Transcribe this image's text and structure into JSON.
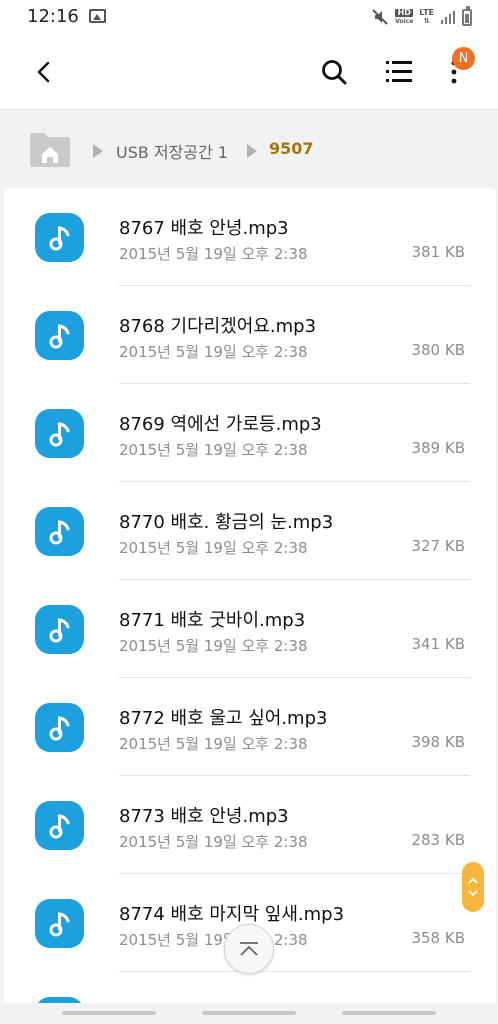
{
  "status_bar": {
    "time": "12:16",
    "hd_top": "HD",
    "hd_bottom": "Voice",
    "lte": "LTE"
  },
  "app_bar": {
    "back_icon": "back-arrow-icon",
    "search_icon": "search-icon",
    "list_icon": "list-view-icon",
    "more_icon": "more-vert-icon",
    "badge": "N"
  },
  "breadcrumb": {
    "home_icon": "home-folder-icon",
    "items": [
      "USB 저장공간 1",
      "9507"
    ]
  },
  "files": [
    {
      "name": "8767 배호  안녕.mp3",
      "date": "2015년 5월 19일 오후 2:38",
      "size": "381 KB"
    },
    {
      "name": "8768 기다리겠어요.mp3",
      "date": "2015년 5월 19일 오후 2:38",
      "size": "380 KB"
    },
    {
      "name": "8769 역에선 가로등.mp3",
      "date": "2015년 5월 19일 오후 2:38",
      "size": "389 KB"
    },
    {
      "name": "8770 배호. 황금의 눈.mp3",
      "date": "2015년 5월 19일 오후 2:38",
      "size": "327 KB"
    },
    {
      "name": "8771 배호  굿바이.mp3",
      "date": "2015년 5월 19일 오후 2:38",
      "size": "341 KB"
    },
    {
      "name": "8772 배호  울고 싶어.mp3",
      "date": "2015년 5월 19일 오후 2:38",
      "size": "398 KB"
    },
    {
      "name": "8773 배호  안녕.mp3",
      "date": "2015년 5월 19일 오후 2:38",
      "size": "283 KB"
    },
    {
      "name": "8774 배호  마지막 잎새.mp3",
      "date": "2015년 5월 19일 오후 2:38",
      "size": "358 KB"
    }
  ],
  "colors": {
    "accent": "#1da0de",
    "breadcrumb_active": "#a5750a",
    "badge": "#f37021",
    "fast_scroll": "#f5b63e"
  }
}
